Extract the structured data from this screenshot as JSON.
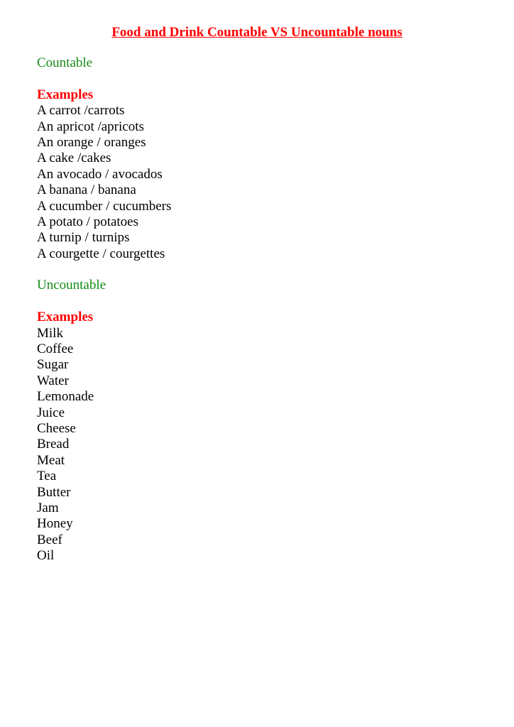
{
  "document": {
    "title": "Food and Drink Countable VS Uncountable nouns",
    "sections": [
      {
        "heading": "Countable",
        "examples_label": "Examples",
        "items": [
          "A carrot /carrots",
          "An apricot /apricots",
          "An orange / oranges",
          "A cake /cakes",
          "An avocado / avocados",
          "A banana / banana",
          "A cucumber / cucumbers",
          "A potato / potatoes",
          "A turnip / turnips",
          "A courgette / courgettes"
        ]
      },
      {
        "heading": "Uncountable",
        "examples_label": "Examples",
        "items": [
          "Milk",
          "Coffee",
          "Sugar",
          "Water",
          "Lemonade",
          "Juice",
          "Cheese",
          "Bread",
          "Meat",
          "Tea",
          "Butter",
          "Jam",
          "Honey",
          "Beef",
          "Oil"
        ]
      }
    ]
  },
  "colors": {
    "title": "#ff0000",
    "section_heading": "#168a16",
    "examples_label": "#ff0000",
    "body_text": "#000000"
  }
}
